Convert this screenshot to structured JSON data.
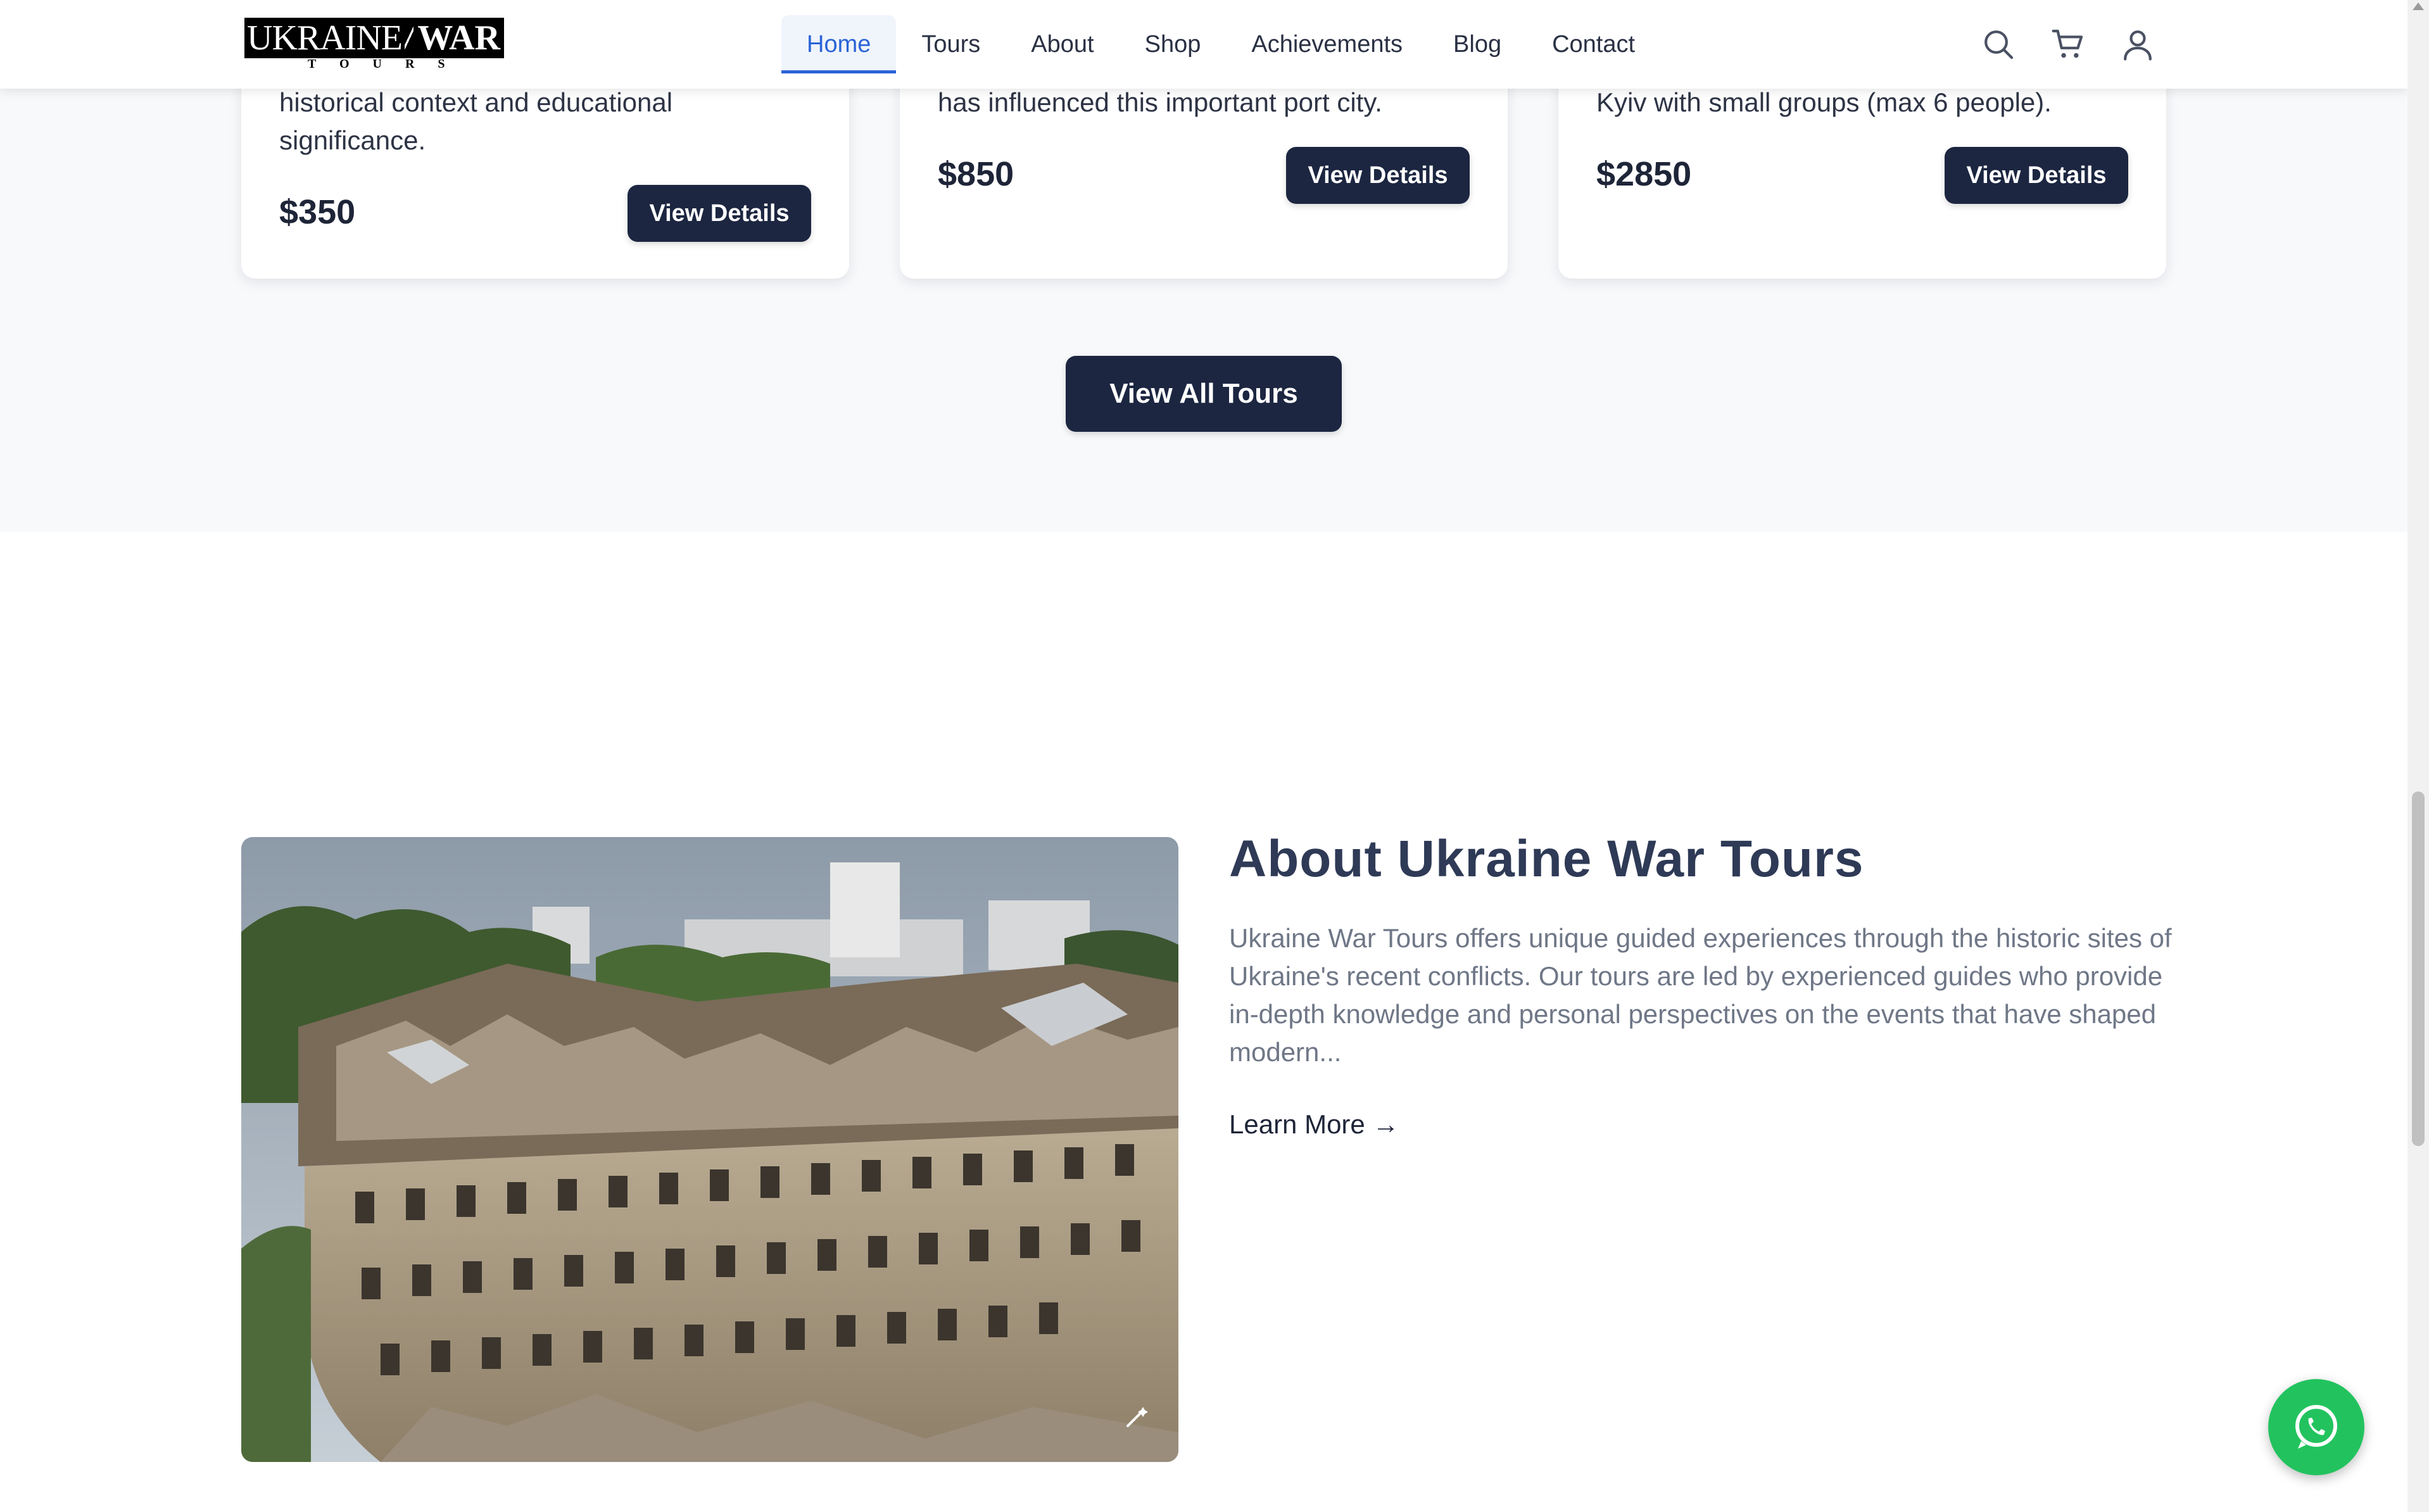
{
  "brand": {
    "logo_main": "UKRAINE",
    "logo_war": "WAR",
    "logo_sub": "TOURS"
  },
  "nav": {
    "items": [
      {
        "label": "Home",
        "active": true
      },
      {
        "label": "Tours",
        "active": false
      },
      {
        "label": "About",
        "active": false
      },
      {
        "label": "Shop",
        "active": false
      },
      {
        "label": "Achievements",
        "active": false
      },
      {
        "label": "Blog",
        "active": false
      },
      {
        "label": "Contact",
        "active": false
      }
    ],
    "icons": [
      "search-icon",
      "cart-icon",
      "user-icon"
    ]
  },
  "tours": {
    "cards": [
      {
        "description": "historical context and educational significance.",
        "price": "$350",
        "button": "View Details"
      },
      {
        "description": "has influenced this important port city.",
        "price": "$850",
        "button": "View Details"
      },
      {
        "description": "Kyiv with small groups (max 6 people).",
        "price": "$2850",
        "button": "View Details"
      }
    ],
    "view_all_label": "View All Tours"
  },
  "about": {
    "title": "About Ukraine War Tours",
    "text": "Ukraine War Tours offers unique guided experiences through the historic sites of Ukraine's recent conflicts. Our tours are led by experienced guides who provide in-depth knowledge and personal perspectives on the events that have shaped modern...",
    "learn_more": "Learn More →",
    "image_icon": "magic-wand-icon"
  },
  "whatsapp": {
    "icon": "whatsapp-icon"
  },
  "colors": {
    "primary": "#1c2641",
    "accent": "#2b64d6",
    "whatsapp": "#22c35e",
    "section_bg": "#f8f9fb"
  }
}
